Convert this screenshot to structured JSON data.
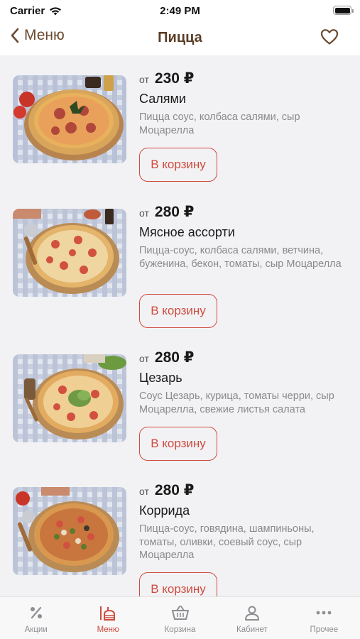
{
  "status_bar": {
    "carrier": "Carrier",
    "time": "2:49 PM",
    "battery_level": 1.0
  },
  "nav": {
    "back_label": "Меню",
    "title": "Пицца",
    "icons": {
      "back": "chevron-left-icon",
      "favorite": "heart-icon"
    }
  },
  "products": [
    {
      "price_prefix": "от",
      "price": "230 ₽",
      "name": "Салями",
      "description": "Пицца соус, колбаса салями, сыр Моцарелла",
      "button_label": "В корзину"
    },
    {
      "price_prefix": "от",
      "price": "280 ₽",
      "name": "Мясное ассорти",
      "description": "Пицца-соус, колбаса салями, ветчина, буженина, бекон, томаты, сыр Моцарелла",
      "button_label": "В корзину"
    },
    {
      "price_prefix": "от",
      "price": "280 ₽",
      "name": "Цезарь",
      "description": "Соус Цезарь, курица, томаты черри, сыр Моцарелла, свежие листья салата",
      "button_label": "В корзину"
    },
    {
      "price_prefix": "от",
      "price": "280 ₽",
      "name": "Коррида",
      "description": "Пицца-соус, говядина, шампиньоны, томаты, оливки, соевый соус, сыр Моцарелла",
      "button_label": "В корзину"
    }
  ],
  "tab_bar": {
    "tabs": [
      {
        "label": "Акции",
        "icon": "percent-icon",
        "active": false
      },
      {
        "label": "Меню",
        "icon": "menu-food-icon",
        "active": true
      },
      {
        "label": "Корзина",
        "icon": "basket-icon",
        "active": false
      },
      {
        "label": "Кабинет",
        "icon": "person-icon",
        "active": false
      },
      {
        "label": "Прочее",
        "icon": "more-icon",
        "active": false
      }
    ]
  },
  "colors": {
    "accent": "#cf4a3e",
    "brand_brown": "#5a3d26",
    "background": "#f2f2f4"
  }
}
